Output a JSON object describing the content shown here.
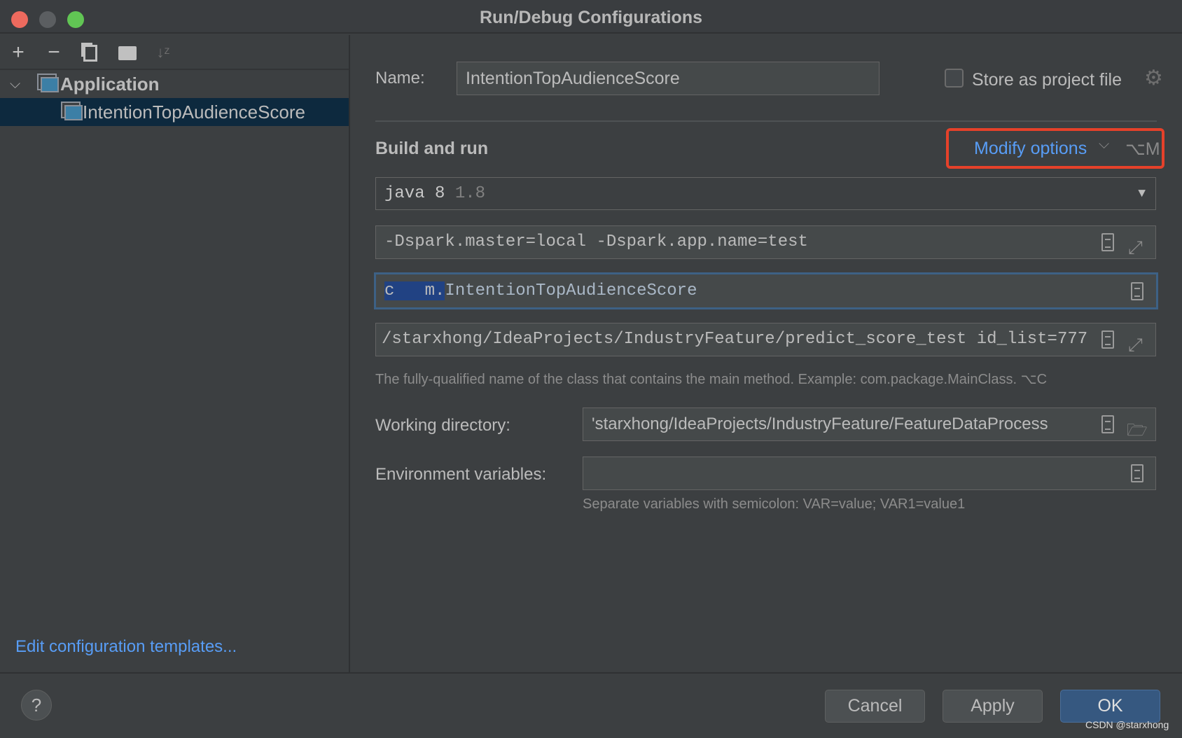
{
  "window": {
    "title": "Run/Debug Configurations"
  },
  "toolbar": {
    "icons": [
      "plus-icon",
      "minus-icon",
      "copy-icon",
      "new-folder-icon",
      "sort-alpha-icon"
    ]
  },
  "tree": {
    "group": "Application",
    "item": "IntentionTopAudienceScore"
  },
  "sidebar": {
    "edit_templates": "Edit configuration templates..."
  },
  "form": {
    "name_label": "Name:",
    "name_value": "IntentionTopAudienceScore",
    "store_label": "Store as project file",
    "store_checked": false,
    "section_title": "Build and run",
    "modify_options": "Modify options",
    "modify_shortcut": "⌥M",
    "jre_value": "java 8",
    "jre_version": "1.8",
    "vm_options": "-Dspark.master=local -Dspark.app.name=test",
    "main_class_prefix": "c   m.",
    "main_class": "IntentionTopAudienceScore",
    "program_args": "/starxhong/IdeaProjects/IndustryFeature/predict_score_test id_list=777",
    "main_class_hint": "The fully-qualified name of the class that contains the main method. Example: com.package.MainClass. ⌥C",
    "workdir_label": "Working directory:",
    "workdir_value": "'starxhong/IdeaProjects/IndustryFeature/FeatureDataProcess",
    "env_label": "Environment variables:",
    "env_value": "",
    "env_hint": "Separate variables with semicolon: VAR=value; VAR1=value1"
  },
  "buttons": {
    "help": "?",
    "cancel": "Cancel",
    "apply": "Apply",
    "ok": "OK"
  },
  "watermark": "CSDN @starxhong",
  "colors": {
    "accent": "#589df6",
    "highlight_box": "#e5412a",
    "selection": "#0d293e",
    "ok": "#365880"
  }
}
